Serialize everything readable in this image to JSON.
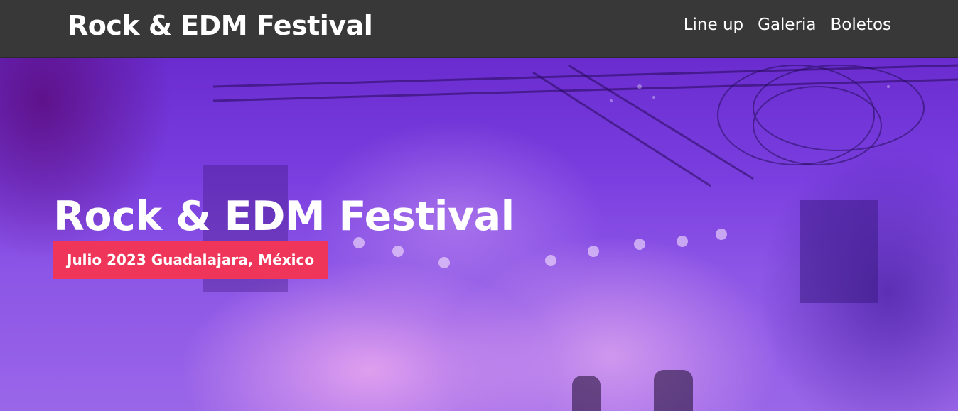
{
  "header": {
    "site_title": "Rock & EDM Festival",
    "nav": [
      {
        "label": "Line up"
      },
      {
        "label": "Galeria"
      },
      {
        "label": "Boletos"
      }
    ]
  },
  "hero": {
    "title": "Rock & EDM Festival",
    "subtitle": "Julio 2023 Guadalajara, México"
  },
  "colors": {
    "topbar": "#383838",
    "badge": "#f0355a",
    "hero_tint": "#7b3fe0"
  }
}
